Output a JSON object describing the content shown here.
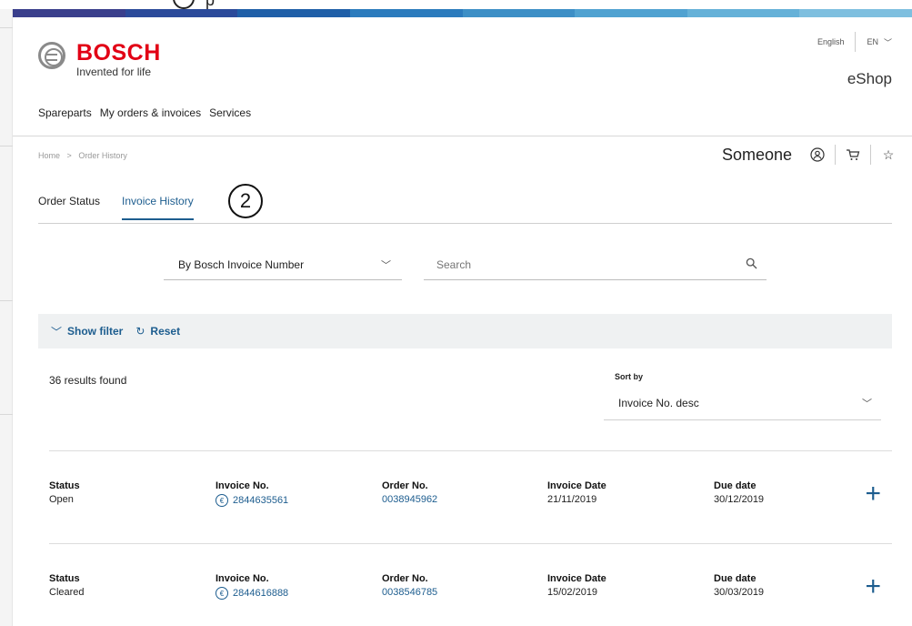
{
  "top_partial": {
    "callout": "",
    "text": "p"
  },
  "supergraphic_colors": [
    "#3a3f8c",
    "#2b4a9a",
    "#1f5fa8",
    "#2b7bbd",
    "#3d8fc6",
    "#50a2d1",
    "#65b1d8",
    "#7ebfdf"
  ],
  "header": {
    "brand": "BOSCH",
    "tagline": "Invented for life",
    "language": "English",
    "language_code": "EN",
    "shop_name": "eShop"
  },
  "nav": {
    "items": [
      {
        "label": "Spareparts"
      },
      {
        "label": "My orders & invoices"
      },
      {
        "label": "Services"
      }
    ]
  },
  "breadcrumb": {
    "home": "Home",
    "separator": ">",
    "current": "Order History"
  },
  "user": {
    "name": "Someone",
    "icons": [
      "user-icon",
      "cart-icon",
      "star-icon"
    ]
  },
  "tabs": [
    {
      "label": "Order Status",
      "active": false
    },
    {
      "label": "Invoice History",
      "active": true
    }
  ],
  "callout": {
    "number": "2"
  },
  "search": {
    "type_label": "By Bosch Invoice Number",
    "placeholder": "Search"
  },
  "filter_bar": {
    "show_filter": "Show filter",
    "reset": "Reset"
  },
  "results": {
    "count_text": "36 results found"
  },
  "sort": {
    "label": "Sort by",
    "value": "Invoice No. desc"
  },
  "invoices": [
    {
      "status_label": "Status",
      "status": "Open",
      "invoice_label": "Invoice No.",
      "invoice_no": "2844635561",
      "order_label": "Order No.",
      "order_no": "0038945962",
      "invoice_date_label": "Invoice Date",
      "invoice_date": "21/11/2019",
      "due_label": "Due date",
      "due_date": "30/12/2019"
    },
    {
      "status_label": "Status",
      "status": "Cleared",
      "invoice_label": "Invoice No.",
      "invoice_no": "2844616888",
      "order_label": "Order No.",
      "order_no": "0038546785",
      "invoice_date_label": "Invoice Date",
      "invoice_date": "15/02/2019",
      "due_label": "Due date",
      "due_date": "30/03/2019"
    }
  ],
  "colors": {
    "brand_red": "#e20015",
    "link_blue": "#1d5d8f",
    "filter_bg": "#eff1f2"
  }
}
